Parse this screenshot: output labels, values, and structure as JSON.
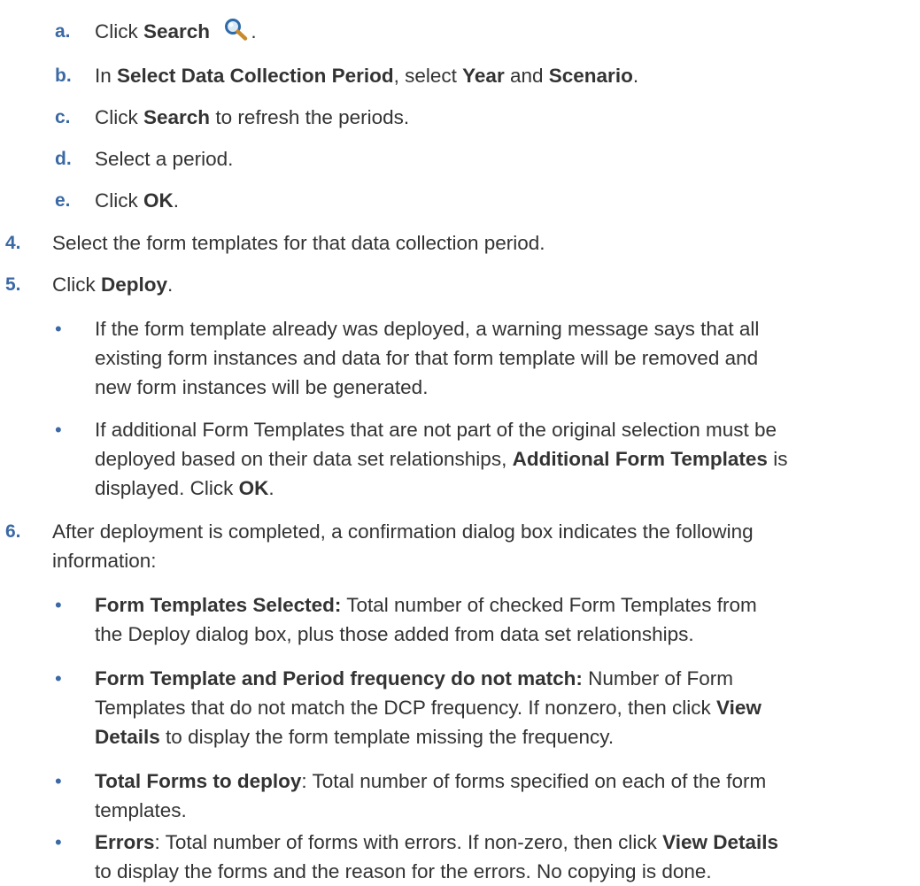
{
  "substeps": [
    {
      "marker": "a.",
      "t1": "Click ",
      "b1": "Search",
      "t2": " ",
      "after_icon": "."
    },
    {
      "marker": "b.",
      "t1": "In ",
      "b1": "Select Data Collection Period",
      "t2": ", select ",
      "b2": "Year",
      "t3": " and ",
      "b3": "Scenario",
      "t4": "."
    },
    {
      "marker": "c.",
      "t1": "Click ",
      "b1": "Search",
      "t2": " to refresh the periods."
    },
    {
      "marker": "d.",
      "t1": "Select a period."
    },
    {
      "marker": "e.",
      "t1": "Click ",
      "b1": "OK",
      "t2": "."
    }
  ],
  "steps": [
    {
      "marker": "4.",
      "t1": "Select the form templates for that data collection period."
    },
    {
      "marker": "5.",
      "t1": "Click ",
      "b1": "Deploy",
      "t2": "."
    },
    {
      "marker": "6.",
      "line1": "After deployment is completed, a confirmation dialog box indicates the following",
      "line2": "information:"
    }
  ],
  "bullet_glyph": "•",
  "step5_bullets": [
    {
      "lines": [
        "If the form template already was deployed, a warning message says that all",
        "existing form instances and data for that form template will be removed and",
        "new form instances will be generated."
      ]
    },
    {
      "l1": "If additional Form Templates that are not part of the original selection must be",
      "l2a": "deployed based on their data set relationships, ",
      "l2b": "Additional Form Templates",
      "l2c": " is",
      "l3a": "displayed. Click ",
      "l3b": "OK",
      "l3c": "."
    }
  ],
  "step6_bullets": [
    {
      "b": "Form Templates Selected:",
      "t1": " Total number of checked Form Templates from",
      "l2": "the Deploy dialog box, plus those added from data set relationships."
    },
    {
      "b": "Form Template and Period frequency do not match:",
      "t1": " Number of Form",
      "l2a": "Templates that do not match the DCP frequency. If nonzero, then click ",
      "l2b": "View",
      "l3b": "Details",
      "l3c": " to display the form template missing the frequency."
    },
    {
      "b": "Total Forms to deploy",
      "t1": ": Total number of forms specified on each of the form",
      "l2": "templates."
    },
    {
      "b": "Errors",
      "t1": ": Total number of forms with errors. If non-zero, then click ",
      "b2": "View Details",
      "l2": "to display the forms and the reason for the errors. No copying is done."
    }
  ],
  "icon": "search-magnifier-icon"
}
